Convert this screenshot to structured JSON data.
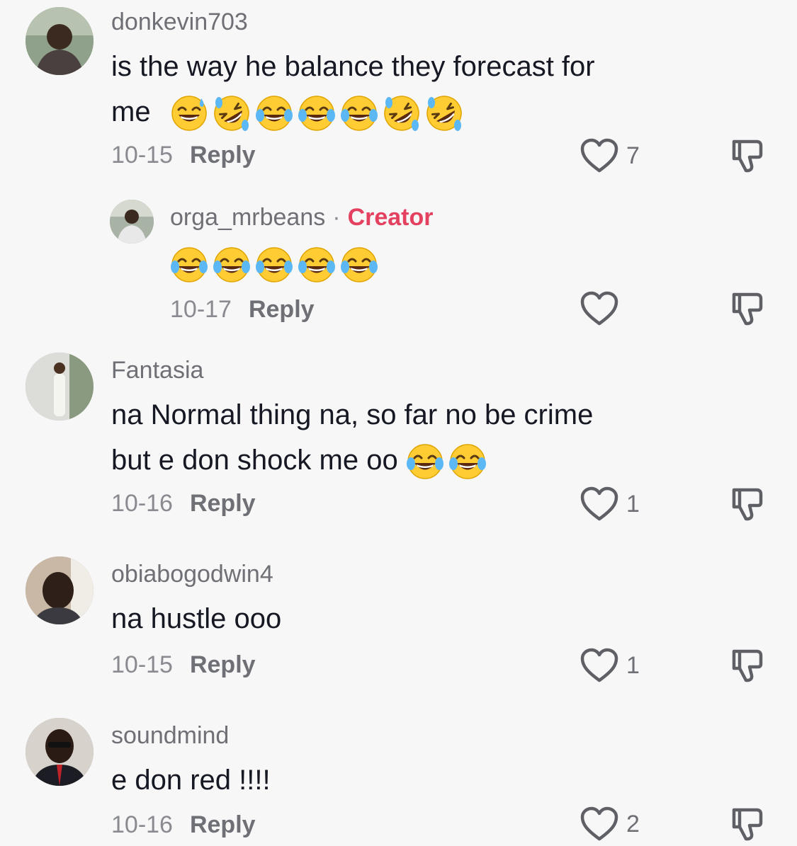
{
  "colors": {
    "accent": "#e4405f",
    "text": "#161823",
    "muted": "#8a8b91",
    "background": "#f7f7f7"
  },
  "comments": [
    {
      "username": "donkevin703",
      "text_line1": "is the way he balance they forecast for",
      "text_line2": "me",
      "emojis": [
        "grinning-sweat-emoji",
        "rofl-emoji",
        "joy-emoji",
        "joy-emoji",
        "joy-emoji",
        "rofl-emoji",
        "rofl-emoji"
      ],
      "date": "10-15",
      "reply_label": "Reply",
      "likes": "7"
    },
    {
      "username": "orga_mrbeans",
      "separator": "·",
      "badge": "Creator",
      "emojis": [
        "joy-emoji",
        "joy-emoji",
        "joy-emoji",
        "joy-emoji",
        "joy-emoji"
      ],
      "date": "10-17",
      "reply_label": "Reply",
      "likes": ""
    },
    {
      "username": "Fantasia",
      "text_line1": "na Normal thing na, so far no be crime",
      "text_line2": "but e don shock me oo",
      "emojis": [
        "joy-emoji",
        "joy-emoji"
      ],
      "date": "10-16",
      "reply_label": "Reply",
      "likes": "1"
    },
    {
      "username": "obiabogodwin4",
      "text_line1": "na hustle ooo",
      "date": "10-15",
      "reply_label": "Reply",
      "likes": "1"
    },
    {
      "username": "soundmind",
      "text_line1": "e don red !!!!",
      "date": "10-16",
      "reply_label": "Reply",
      "likes": "2"
    }
  ]
}
